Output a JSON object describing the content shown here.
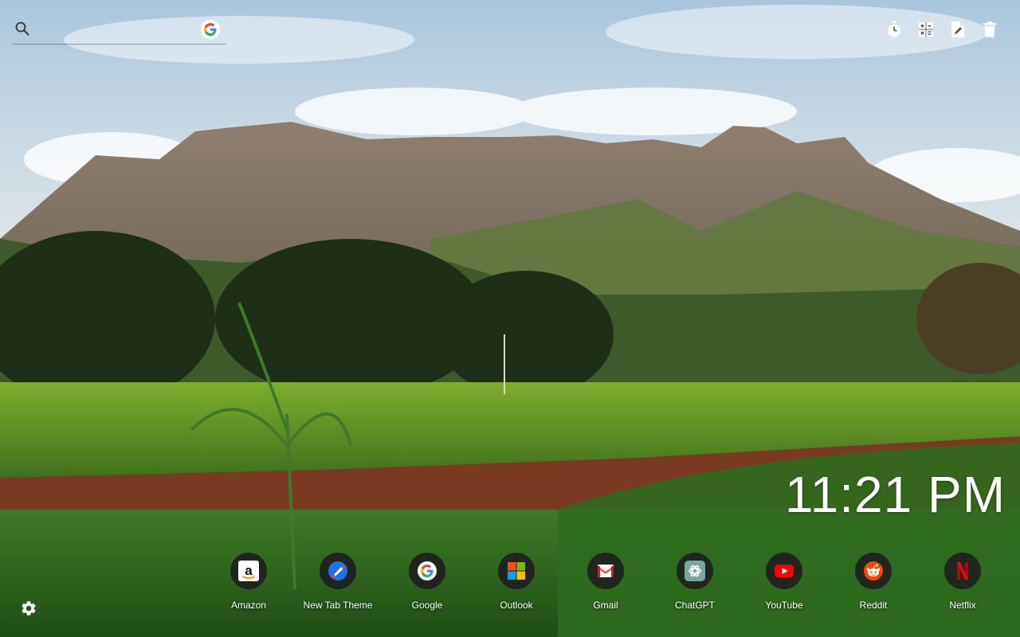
{
  "search": {
    "placeholder": ""
  },
  "toolbar": {
    "items": [
      "timer-icon",
      "calculator-icon",
      "notes-icon",
      "trash-icon"
    ]
  },
  "clock": {
    "time": "11:21 PM"
  },
  "shortcuts": [
    {
      "label": "Amazon",
      "icon": "amazon-icon"
    },
    {
      "label": "New Tab Theme",
      "icon": "new-tab-theme-icon"
    },
    {
      "label": "Google",
      "icon": "google-icon"
    },
    {
      "label": "Outlook",
      "icon": "outlook-icon"
    },
    {
      "label": "Gmail",
      "icon": "gmail-icon"
    },
    {
      "label": "ChatGPT",
      "icon": "chatgpt-icon"
    },
    {
      "label": "YouTube",
      "icon": "youtube-icon"
    },
    {
      "label": "Reddit",
      "icon": "reddit-icon"
    },
    {
      "label": "Netflix",
      "icon": "netflix-icon"
    }
  ],
  "colors": {
    "google_blue": "#4285F4",
    "google_red": "#EA4335",
    "google_yellow": "#FBBC05",
    "google_green": "#34A853",
    "youtube_red": "#FF0000",
    "reddit_orange": "#FF4500",
    "netflix_red": "#E50914",
    "chatgpt_teal": "#74AA9C"
  }
}
